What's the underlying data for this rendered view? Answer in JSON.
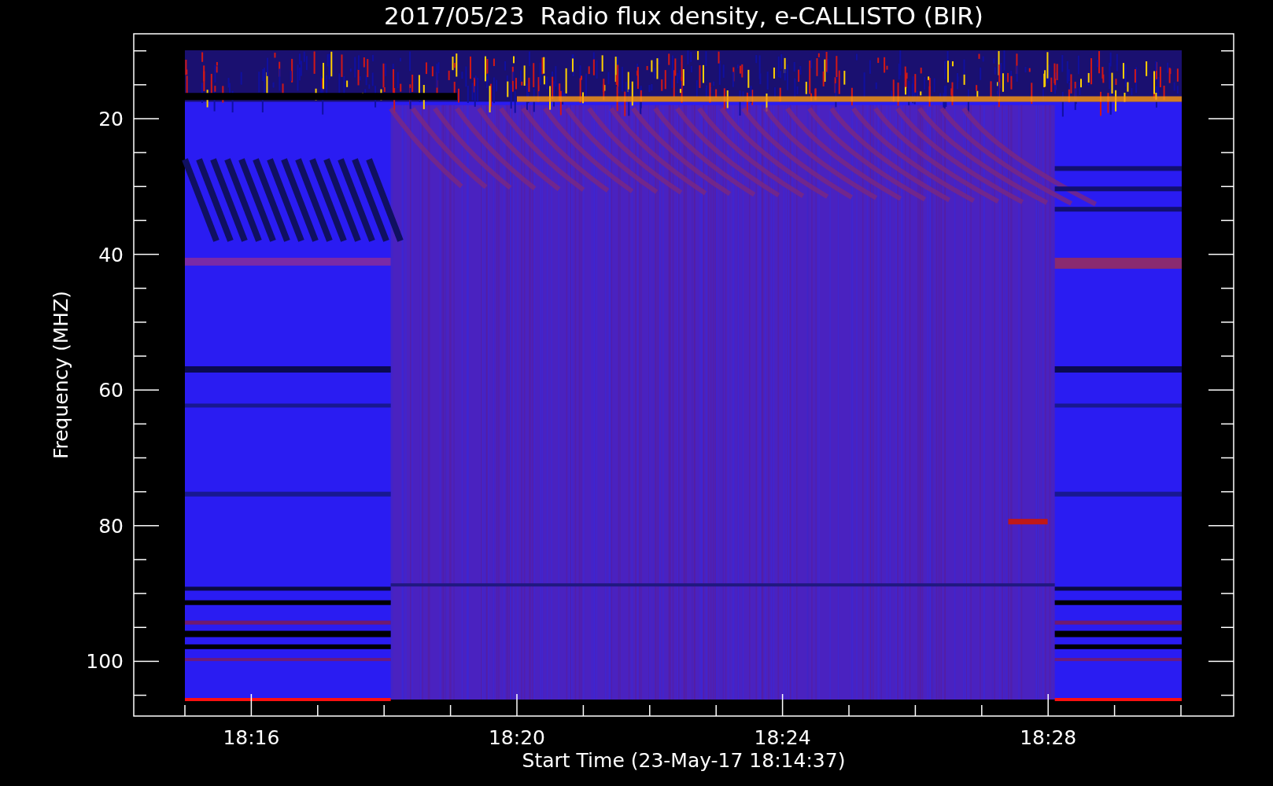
{
  "title": "2017/05/23  Radio flux density, e-CALLISTO (BIR)",
  "y_axis": {
    "label": "Frequency (MHZ)",
    "ticks": [
      "20",
      "40",
      "60",
      "80",
      "100"
    ]
  },
  "x_axis": {
    "label": "Start Time (23-May-17 18:14:37)",
    "ticks": [
      "18:16",
      "18:20",
      "18:24",
      "18:28"
    ]
  }
}
